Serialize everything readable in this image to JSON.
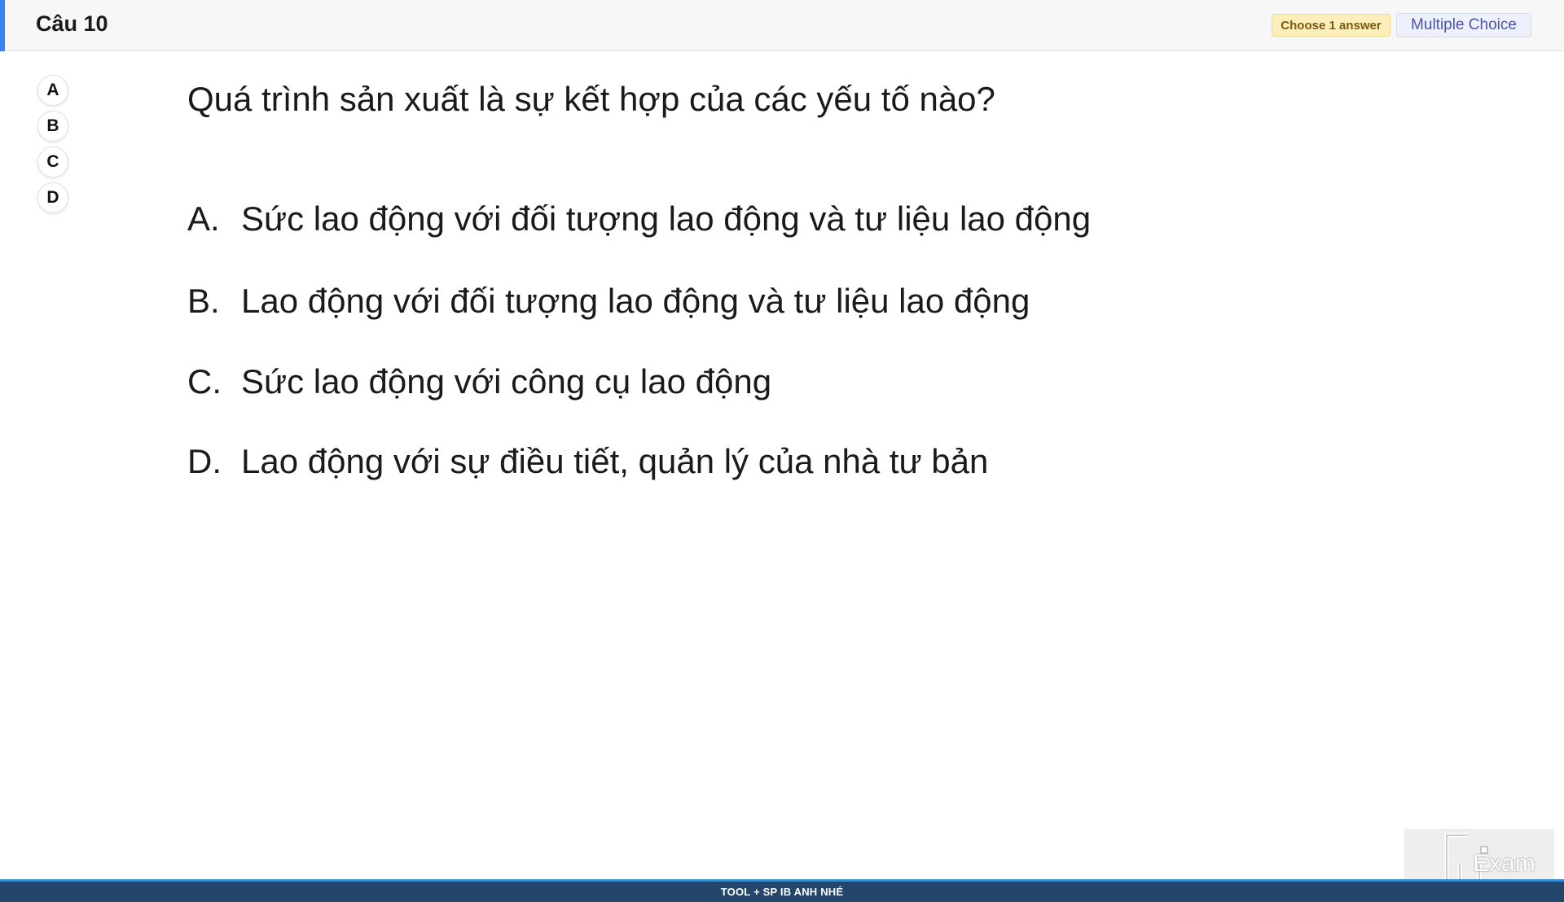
{
  "header": {
    "question_number": "Câu 10",
    "answer_count_badge": "Choose 1 answer",
    "question_type_badge": "Multiple Choice"
  },
  "answer_selector": [
    "A",
    "B",
    "C",
    "D"
  ],
  "question": {
    "text": "Quá trình sản xuất là sự kết hợp của các yếu tố nào?",
    "options": [
      {
        "letter": "A.",
        "text": "Sức lao động với đối tượng lao động và tư liệu lao động"
      },
      {
        "letter": "B.",
        "text": "Lao động với đối tượng lao động và tư liệu lao động"
      },
      {
        "letter": "C.",
        "text": "Sức lao động với công cụ lao động"
      },
      {
        "letter": "D.",
        "text": "Lao động với sự điều tiết, quản lý của nhà tư bản"
      }
    ]
  },
  "watermark": {
    "text": "Exam",
    "icon": "fu-logo-icon"
  },
  "footer": {
    "text": "TOOL + SP IB ANH NHÉ"
  },
  "colors": {
    "header_accent": "#3b82f6",
    "footer_bg": "#24466b",
    "badge_choose_bg": "#fdefb9",
    "badge_type_text": "#4a55a8"
  }
}
